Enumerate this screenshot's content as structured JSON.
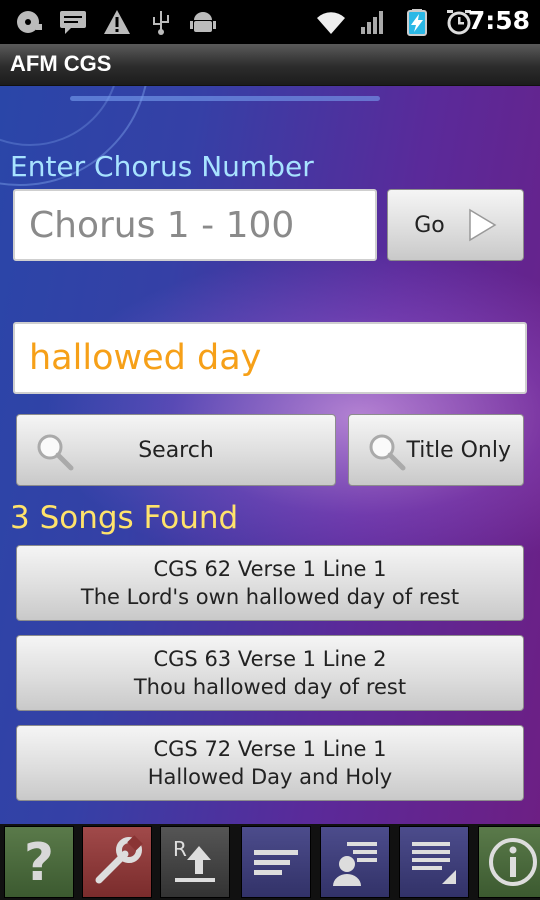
{
  "status_bar": {
    "time": "7:58",
    "icons": [
      "cd-icon",
      "message-icon",
      "warning-icon",
      "usb-icon",
      "android-icon",
      "wifi-icon",
      "signal-icon",
      "battery-charging-icon",
      "alarm-icon"
    ]
  },
  "app": {
    "title": "AFM CGS"
  },
  "chorus": {
    "label": "Enter Chorus Number",
    "placeholder": "Chorus 1 - 100",
    "go_label": "Go"
  },
  "search": {
    "value": "hallowed day",
    "search_label": "Search",
    "title_only_label": "Title Only"
  },
  "results": {
    "heading": "3 Songs Found",
    "items": [
      {
        "ref": "CGS 62 Verse 1 Line 1",
        "text": "The Lord's own hallowed day of rest"
      },
      {
        "ref": "CGS 63 Verse 1 Line 2",
        "text": "Thou hallowed day of rest"
      },
      {
        "ref": "CGS 72 Verse 1 Line 1",
        "text": "Hallowed Day and Holy"
      }
    ]
  },
  "toolbar": {
    "buttons": [
      {
        "name": "help-icon",
        "color": "#4d6b3f"
      },
      {
        "name": "wrench-icon",
        "color": "#8f3a3a"
      },
      {
        "name": "upload-icon",
        "color": "#444444"
      },
      {
        "name": "lines-icon",
        "color": "#3f3f7a"
      },
      {
        "name": "contact-list-icon",
        "color": "#3f3f7a"
      },
      {
        "name": "edit-list-icon",
        "color": "#3f3f7a"
      },
      {
        "name": "info-icon",
        "color": "#4d6b3f"
      }
    ]
  },
  "colors": {
    "accent_yellow": "#ffe36b",
    "label_blue": "#a8e3ff",
    "search_text": "#f6a018"
  }
}
